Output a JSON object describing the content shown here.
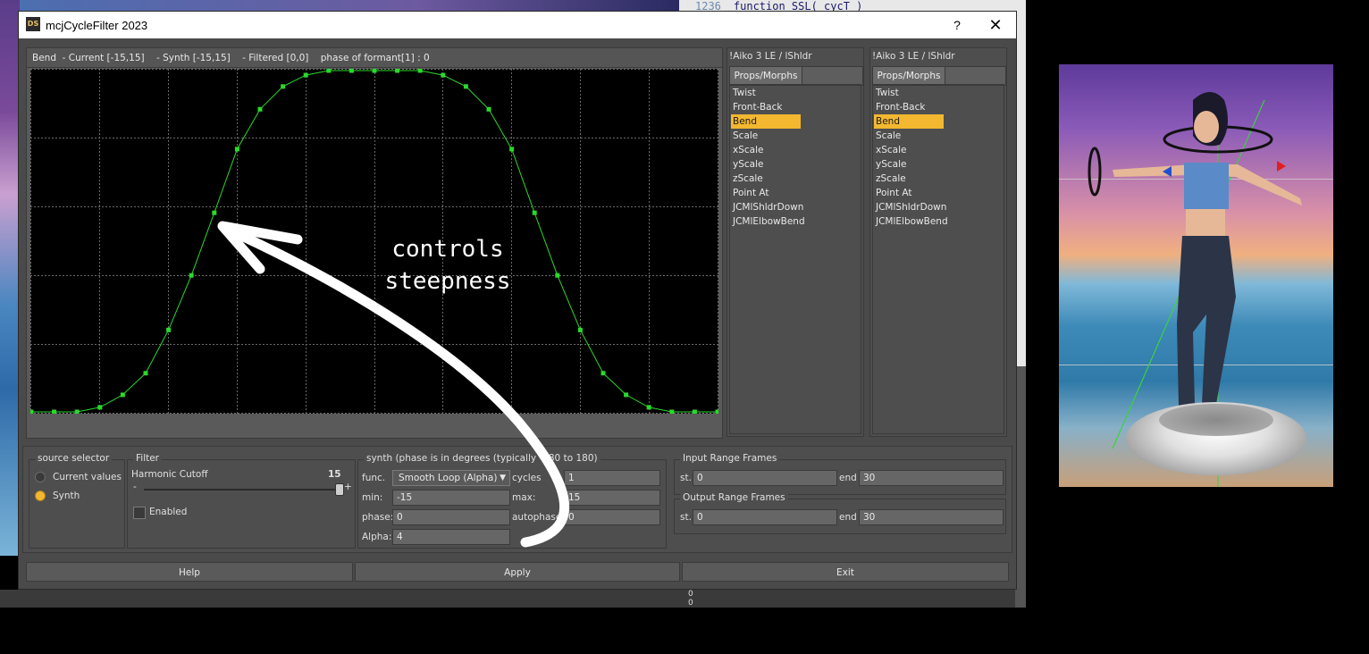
{
  "background": {
    "code_line_number": "1236",
    "code_line_text": "function  SSL( cycT )",
    "bottom_numbers": [
      "0",
      "0"
    ]
  },
  "window": {
    "app_icon": "DS",
    "title": "mcjCycleFilter 2023",
    "help_label": "?",
    "close_label": "✕"
  },
  "graph": {
    "header": "Bend  - Current [-15,15]    - Synth [-15,15]    - Filtered [0,0]    phase of formant[1] : 0",
    "curve_color": "#2bd92b",
    "grid_color": "#6a6a6a"
  },
  "chart_data": {
    "type": "line",
    "x": [
      0,
      1,
      2,
      3,
      4,
      5,
      6,
      7,
      8,
      9,
      10,
      11,
      12,
      13,
      14,
      15,
      16,
      17,
      18,
      19,
      20,
      21,
      22,
      23,
      24,
      25,
      26,
      27,
      28,
      29,
      30
    ],
    "series": [
      {
        "values": [
          -15,
          -15,
          -15,
          -14.6,
          -13.5,
          -11.6,
          -7.8,
          -3,
          2.5,
          8.1,
          11.6,
          13.6,
          14.6,
          15,
          15,
          15,
          15,
          15,
          14.6,
          13.6,
          11.6,
          8.1,
          2.5,
          -3,
          -7.8,
          -11.6,
          -13.5,
          -14.6,
          -15,
          -15,
          -15
        ]
      }
    ],
    "xlim": [
      0,
      30
    ],
    "ylim": [
      -15,
      15
    ],
    "grid": true
  },
  "annotation": {
    "lines": [
      "controls",
      "steepness"
    ]
  },
  "figure_panels": [
    {
      "title": "!Aiko 3 LE / lShldr",
      "tab": "Props/Morphs",
      "items": [
        "Twist",
        "Front-Back",
        "Bend",
        "Scale",
        "xScale",
        "yScale",
        "zScale",
        "Point At",
        "JCMlShldrDown",
        "JCMlElbowBend"
      ],
      "selected": "Bend"
    },
    {
      "title": "!Aiko 3 LE / lShldr",
      "tab": "Props/Morphs",
      "items": [
        "Twist",
        "Front-Back",
        "Bend",
        "Scale",
        "xScale",
        "yScale",
        "zScale",
        "Point At",
        "JCMlShldrDown",
        "JCMlElbowBend"
      ],
      "selected": "Bend"
    }
  ],
  "source_selector": {
    "title": "source selector",
    "options": [
      "Current values",
      "Synth"
    ],
    "selected": "Synth"
  },
  "filter": {
    "title": "Filter",
    "harmonic_label": "Harmonic Cutoff",
    "harmonic_value": "15",
    "slider_min_glyph": "-",
    "slider_max_glyph": "+",
    "slider_level": 1.0,
    "enabled_label": "Enabled",
    "enabled": false
  },
  "synth": {
    "title": "synth (phase is in degrees (typically -180 to 180)",
    "func_label": "func.",
    "func_value": "Smooth Loop (Alpha)",
    "cycles_label": "cycles",
    "cycles_value": "1",
    "min_label": "min:",
    "min_value": "-15",
    "max_label": "max:",
    "max_value": "15",
    "phase_label": "phase:",
    "phase_value": "0",
    "autophase_label": "autophase",
    "autophase_value": "0",
    "alpha_label": "Alpha:",
    "alpha_value": "4"
  },
  "input_range": {
    "title": "Input Range Frames",
    "st_label": "st.",
    "st_value": "0",
    "end_label": "end",
    "end_value": "30"
  },
  "output_range": {
    "title": "Output Range Frames",
    "st_label": "st.",
    "st_value": "0",
    "end_label": "end",
    "end_value": "30"
  },
  "buttons": {
    "help": "Help",
    "apply": "Apply",
    "exit": "Exit"
  },
  "colors": {
    "accent": "#f3b830",
    "window_bg": "#4a4a4a"
  }
}
